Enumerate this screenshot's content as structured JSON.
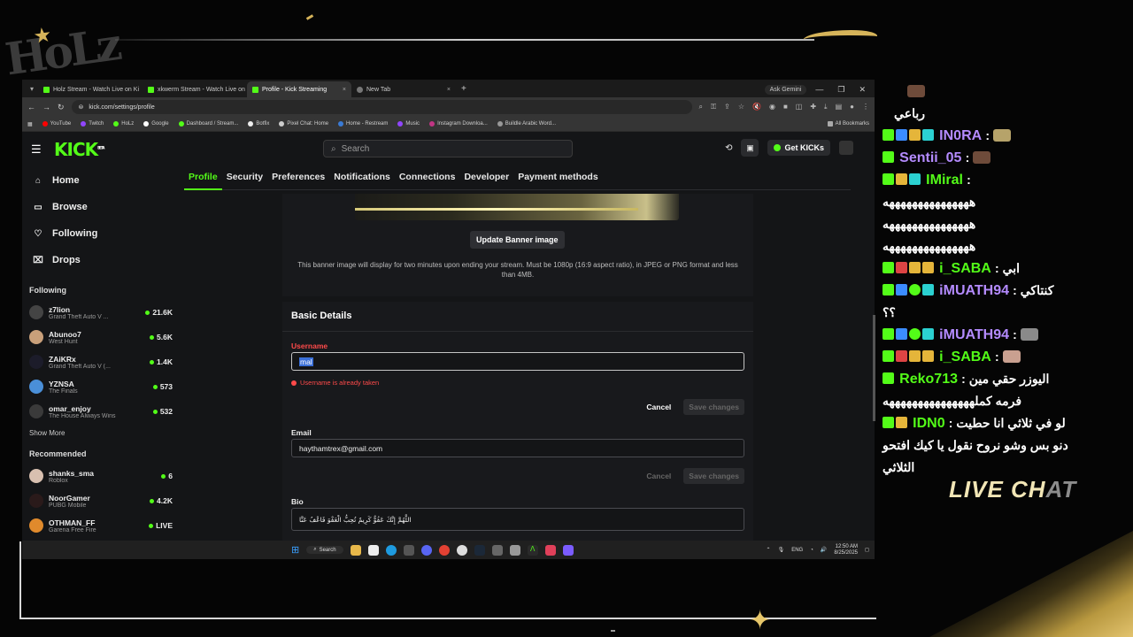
{
  "browser": {
    "tabs": [
      {
        "label": "Holz Stream - Watch Live on Ki",
        "active": false
      },
      {
        "label": "xkwerm Stream - Watch Live on",
        "active": false
      },
      {
        "label": "Profile - Kick Streaming",
        "active": true
      },
      {
        "label": "New Tab",
        "active": false
      }
    ],
    "ask_gemini": "Ask Gemini",
    "url": "kick.com/settings/profile",
    "bookmarks": [
      "YouTube",
      "Twitch",
      "HoLz",
      "Google",
      "Dashboard / Stream...",
      "Botfix",
      "Pixel Chat: Home",
      "Home - Restream",
      "Music",
      "Instagram Downloa...",
      "Buildle Arabic Word..."
    ],
    "all_bookmarks": "All Bookmarks"
  },
  "kick": {
    "logo": "KICK",
    "logo_badge": "BETA",
    "search_placeholder": "Search",
    "get_kicks": "Get KICKs",
    "nav": [
      {
        "label": "Home",
        "icon": "home-icon"
      },
      {
        "label": "Browse",
        "icon": "browse-icon"
      },
      {
        "label": "Following",
        "icon": "heart-icon"
      },
      {
        "label": "Drops",
        "icon": "drops-icon"
      }
    ],
    "following_title": "Following",
    "following": [
      {
        "name": "z7lion",
        "game": "Grand Theft Auto V ...",
        "viewers": "21.6K"
      },
      {
        "name": "Abunoo7",
        "game": "West Hunt",
        "viewers": "5.6K"
      },
      {
        "name": "ZAiKRx",
        "game": "Grand Theft Auto V (...",
        "viewers": "1.4K"
      },
      {
        "name": "YZNSA",
        "game": "The Finals",
        "viewers": "573"
      },
      {
        "name": "omar_enjoy",
        "game": "The House Always Wins",
        "viewers": "532"
      }
    ],
    "show_more": "Show More",
    "recommended_title": "Recommended",
    "recommended": [
      {
        "name": "shanks_sma",
        "game": "Roblox",
        "viewers": "6"
      },
      {
        "name": "NoorGamer",
        "game": "PUBG Mobile",
        "viewers": "4.2K"
      },
      {
        "name": "OTHMAN_FF",
        "game": "Garena Free Fire",
        "viewers": "LIVE"
      }
    ],
    "settings_tabs": [
      "Profile",
      "Security",
      "Preferences",
      "Notifications",
      "Connections",
      "Developer",
      "Payment methods"
    ],
    "update_banner": "Update Banner image",
    "banner_note": "This banner image will display for two minutes upon ending your stream. Must be 1080p (16:9 aspect ratio), in JPEG or PNG format and less than 4MB.",
    "basic_details": "Basic Details",
    "username_label": "Username",
    "username_value": "mal",
    "username_error": "Username is already taken",
    "cancel": "Cancel",
    "save_changes": "Save changes",
    "email_label": "Email",
    "email_value": "haythamtrex@gmail.com",
    "bio_label": "Bio",
    "bio_value": "اللَّهُمَّ إِنَّكَ عَفُوٌّ كَرِيمٌ تُحِبُّ الْعَفْوَ فَاعْفُ عَنَّا"
  },
  "taskbar": {
    "search": "Search",
    "lang": "ENG",
    "time": "12:50 AM",
    "date": "8/25/2025"
  },
  "chat": {
    "messages": [
      {
        "user": "",
        "text": "رباعي",
        "rtl": true
      },
      {
        "user": "IN0RA",
        "text": ":"
      },
      {
        "user": "Sentii_05",
        "text": ":"
      },
      {
        "user": "IMiral",
        "text": ":"
      },
      {
        "user": "",
        "text": "هههههههههههههههه"
      },
      {
        "user": "",
        "text": "هههههههههههههههه"
      },
      {
        "user": "",
        "text": "هههههههههههههههه"
      },
      {
        "user": "i_SABA",
        "text": ": ابي"
      },
      {
        "user": "iMUATH94",
        "text": ": كنتاكي"
      },
      {
        "user": "",
        "text": "؟؟"
      },
      {
        "user": "iMUATH94",
        "text": ":"
      },
      {
        "user": "i_SABA",
        "text": ":"
      },
      {
        "user": "Reko713",
        "text": ": اليوزر حقي مين"
      },
      {
        "user": "",
        "text": "فرمه كملهههههههههههههههه"
      },
      {
        "user": "IDN0",
        "text": ": لو في ثلاثي انا حطيت"
      },
      {
        "user": "",
        "text": "دنو بس وشو نروح نقول يا كيك افتحو"
      },
      {
        "user": "",
        "text": "الثلاثي"
      }
    ],
    "live_chat_a": "LIVE CH",
    "live_chat_b": "AT"
  },
  "overlay": {
    "logo_text": "HoLz"
  },
  "colors": {
    "kick_green": "#53fc18",
    "error_red": "#ff4a4a",
    "gold": "#d6b45a"
  }
}
